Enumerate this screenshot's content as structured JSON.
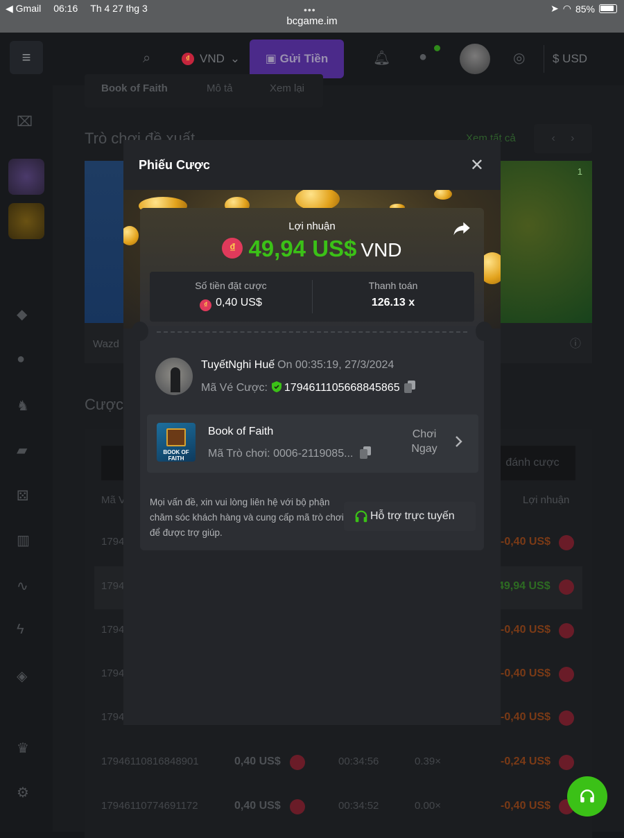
{
  "status_bar": {
    "back_app": "◀ Gmail",
    "time": "06:16",
    "date": "Th 4 27 thg 3",
    "battery": "85%",
    "url": "bcgame.im"
  },
  "nav": {
    "currency": "VND",
    "deposit_label": "Gửi Tiền",
    "usd_label": "$ USD"
  },
  "background": {
    "tabs": [
      "Book of Faith",
      "Mô tả",
      "Xem lại"
    ],
    "recommended_title": "Trò chơi đề xuất",
    "see_all": "Xem tất cả",
    "card_left_text": "Wazd",
    "bets_title": "Cược",
    "bet_button": "đánh cược",
    "col_id": "Mã V",
    "col_profit": "Lợi nhuận",
    "player_count": "1",
    "rows": [
      {
        "id": "1794",
        "profit": "-0,40 US$",
        "type": "neg"
      },
      {
        "id": "1794",
        "profit": "49,94 US$",
        "type": "pos"
      },
      {
        "id": "1794",
        "profit": "-0,40 US$",
        "type": "neg"
      },
      {
        "id": "1794",
        "profit": "-0,40 US$",
        "type": "neg"
      },
      {
        "id": "1794",
        "profit": "-0,40 US$",
        "type": "neg"
      },
      {
        "id": "17946110816848901",
        "amount": "0,40 US$",
        "time": "00:34:56",
        "mult": "0.39×",
        "profit": "-0,24 US$",
        "type": "neg"
      },
      {
        "id": "17946110774691172",
        "amount": "0,40 US$",
        "time": "00:34:52",
        "mult": "0.00×",
        "profit": "-0,40 US$",
        "type": "neg"
      }
    ]
  },
  "modal": {
    "title": "Phiếu Cược",
    "profit_label": "Lợi nhuận",
    "profit_value": "49,94 US$",
    "profit_currency": "VND",
    "coin_symbol": "₫",
    "bet_amount_label": "Số tiền đặt cược",
    "bet_amount_value": "0,40 US$",
    "payout_label": "Thanh toán",
    "payout_value": "126.13 x",
    "user_name": "TuyếtNghi Huế",
    "user_time": "On 00:35:19, 27/3/2024",
    "ticket_label": "Mã Vé Cược:",
    "ticket_id": "1794611105668845865",
    "game_name": "Book of Faith",
    "game_code": "Mã Trò chơi: 0006-2119085...",
    "game_thumb_text": "BOOK OF FAITH",
    "play_line1": "Chơi",
    "play_line2": "Ngay",
    "help_text": "Mọi vấn đề, xin vui lòng liên hệ với bộ phận chăm sóc khách hàng và cung cấp mã trò chơi để được trợ giúp.",
    "support_label": "Hỗ trợ trực tuyến"
  },
  "colors": {
    "accent_green": "#3bc117",
    "coin_red": "#e03a5b",
    "modal_bg": "#232529"
  }
}
